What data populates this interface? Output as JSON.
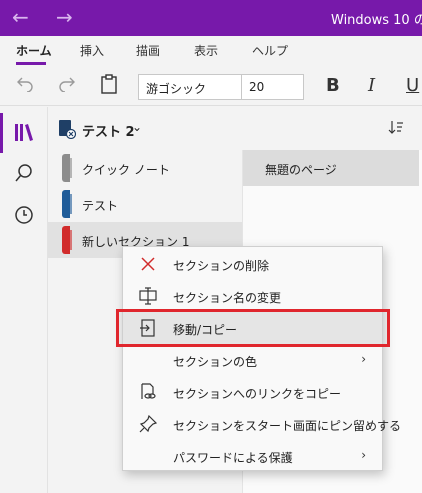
{
  "titlebar": {
    "back_icon": "back-arrow-icon",
    "forward_icon": "forward-arrow-icon",
    "title": "Windows 10 の"
  },
  "ribbon": {
    "tabs": [
      {
        "label": "ホーム",
        "active": true
      },
      {
        "label": "挿入"
      },
      {
        "label": "描画"
      },
      {
        "label": "表示"
      },
      {
        "label": "ヘルプ"
      }
    ],
    "accent": "#7719aa"
  },
  "toolbar": {
    "undo_icon": "undo-icon",
    "redo_icon": "redo-icon",
    "clipboard_icon": "clipboard-icon",
    "font_name": "游ゴシック",
    "font_size": "20",
    "bold_label": "B",
    "italic_label": "I",
    "underline_label": "U"
  },
  "left_rail": {
    "items": [
      "notebooks-icon",
      "search-icon",
      "recent-clock-icon"
    ]
  },
  "notebook": {
    "name": "テスト 2",
    "chevron": "⌄",
    "sort_icon": "sort-icon"
  },
  "sections": [
    {
      "label": "クイック ノート",
      "color": "#8c8c8c"
    },
    {
      "label": "テスト",
      "color": "#1f5c99"
    },
    {
      "label": "新しいセクション 1",
      "color": "#d12b2b",
      "selected": true
    }
  ],
  "pages": [
    {
      "label": "無題のページ"
    }
  ],
  "context_menu": {
    "items": [
      {
        "label": "セクションの削除",
        "icon": "delete-x-icon"
      },
      {
        "label": "セクション名の変更",
        "icon": "rename-icon"
      },
      {
        "label": "移動/コピー",
        "icon": "move-copy-icon",
        "highlighted": true
      },
      {
        "label": "セクションの色",
        "icon": "",
        "submenu": true
      },
      {
        "label": "セクションへのリンクをコピー",
        "icon": "copy-link-icon"
      },
      {
        "label": "セクションをスタート画面にピン留めする",
        "icon": "pin-icon"
      },
      {
        "label": "パスワードによる保護",
        "icon": "",
        "submenu": true
      }
    ],
    "submenu_arrow": "›",
    "highlight_color": "#e0262d"
  }
}
